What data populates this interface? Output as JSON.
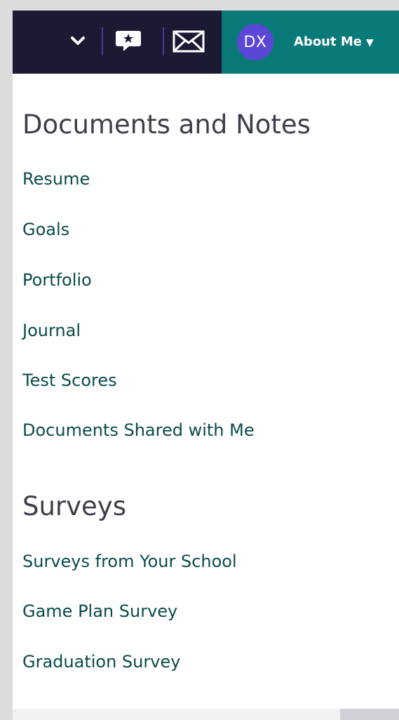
{
  "nav": {
    "avatar_initials": "DX",
    "about_label": "About Me",
    "about_caret": "▼",
    "icons": [
      "chevron-down-icon",
      "chat-star-icon",
      "mail-icon"
    ],
    "colors": {
      "dark": "#1c1a33",
      "teal": "#0a7a78",
      "avatar": "#5b47d6",
      "divider": "#4b3a9b"
    }
  },
  "documents": {
    "title": "Documents and Notes",
    "items": [
      "Resume",
      "Goals",
      "Portfolio",
      "Journal",
      "Test Scores",
      "Documents Shared with Me"
    ]
  },
  "surveys": {
    "title": "Surveys",
    "items": [
      "Surveys from Your School",
      "Game Plan Survey",
      "Graduation Survey"
    ]
  },
  "colors": {
    "link": "#0b4a4a",
    "heading": "#3e3e4a"
  }
}
